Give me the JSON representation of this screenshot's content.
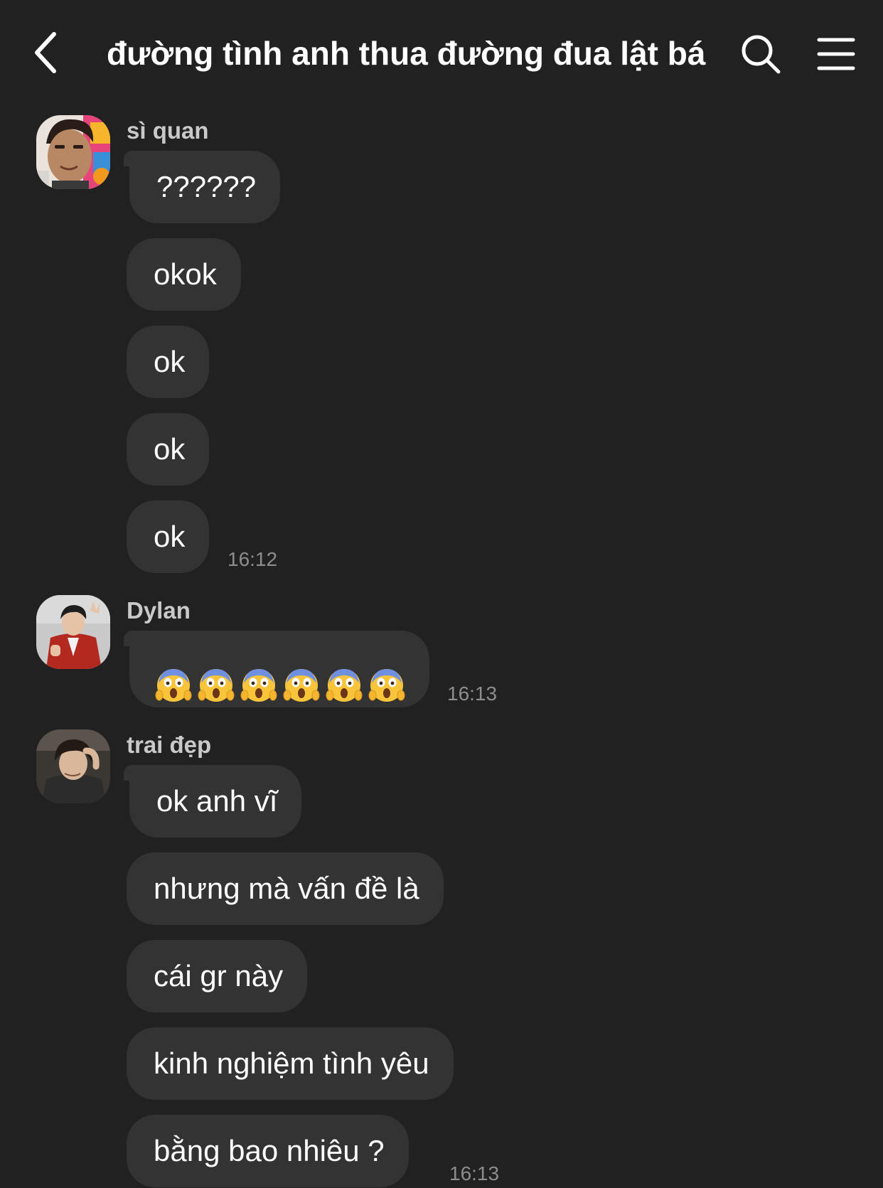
{
  "header": {
    "title": "đường tình anh thua đường đua lật bá",
    "back_icon": "chevron-left-icon",
    "search_icon": "search-icon",
    "menu_icon": "hamburger-menu-icon"
  },
  "groups": [
    {
      "sender": "sì quan",
      "messages": [
        "??????",
        "okok",
        "ok",
        "ok",
        "ok"
      ],
      "time": "16:12"
    },
    {
      "sender": "Dylan",
      "messages": [
        "😱😱😱😱😱😱"
      ],
      "time": "16:13"
    },
    {
      "sender": "trai đẹp",
      "messages": [
        "ok anh vĩ",
        "nhưng mà vấn đề là",
        "cái gr này",
        "kinh nghiệm tình yêu",
        "bằng bao nhiêu ?"
      ],
      "time": "16:13"
    }
  ],
  "colors": {
    "background": "#212121",
    "bubble": "#333333",
    "text": "#ffffff",
    "sender_name": "#c9c9c9",
    "timestamp": "#8d8d8d"
  }
}
